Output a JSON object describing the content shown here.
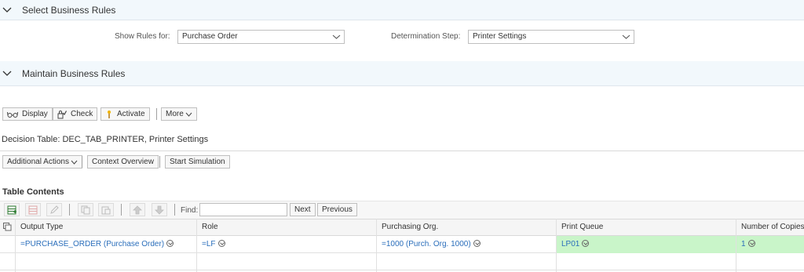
{
  "select_rules": {
    "title": "Select Business Rules",
    "show_rules_label": "Show Rules for:",
    "show_rules_value": "Purchase Order",
    "determination_label": "Determination Step:",
    "determination_value": "Printer Settings"
  },
  "maintain_rules": {
    "title": "Maintain Business Rules"
  },
  "toolbar": {
    "display_label": "Display",
    "check_label": "Check",
    "activate_label": "Activate",
    "more_label": "More"
  },
  "decision_table": {
    "title": "Decision Table: DEC_TAB_PRINTER, Printer Settings"
  },
  "actions": {
    "additional_label": "Additional Actions",
    "context_label": "Context Overview",
    "simulation_label": "Start Simulation"
  },
  "table_contents": {
    "title": "Table Contents",
    "find_label": "Find:",
    "find_value": "",
    "next_label": "Next",
    "previous_label": "Previous"
  },
  "grid": {
    "columns": [
      "Output Type",
      "Role",
      "Purchasing Org.",
      "Print Queue",
      "Number of Copies"
    ],
    "rows": [
      [
        "=PURCHASE_ORDER (Purchase Order)",
        "=LF",
        "=1000 (Purch. Org. 1000)",
        "LP01",
        "1"
      ]
    ]
  },
  "colors": {
    "header_bg": "#f2f8fc",
    "link": "#2a6ebb",
    "highlight": "#c9f5c9"
  }
}
